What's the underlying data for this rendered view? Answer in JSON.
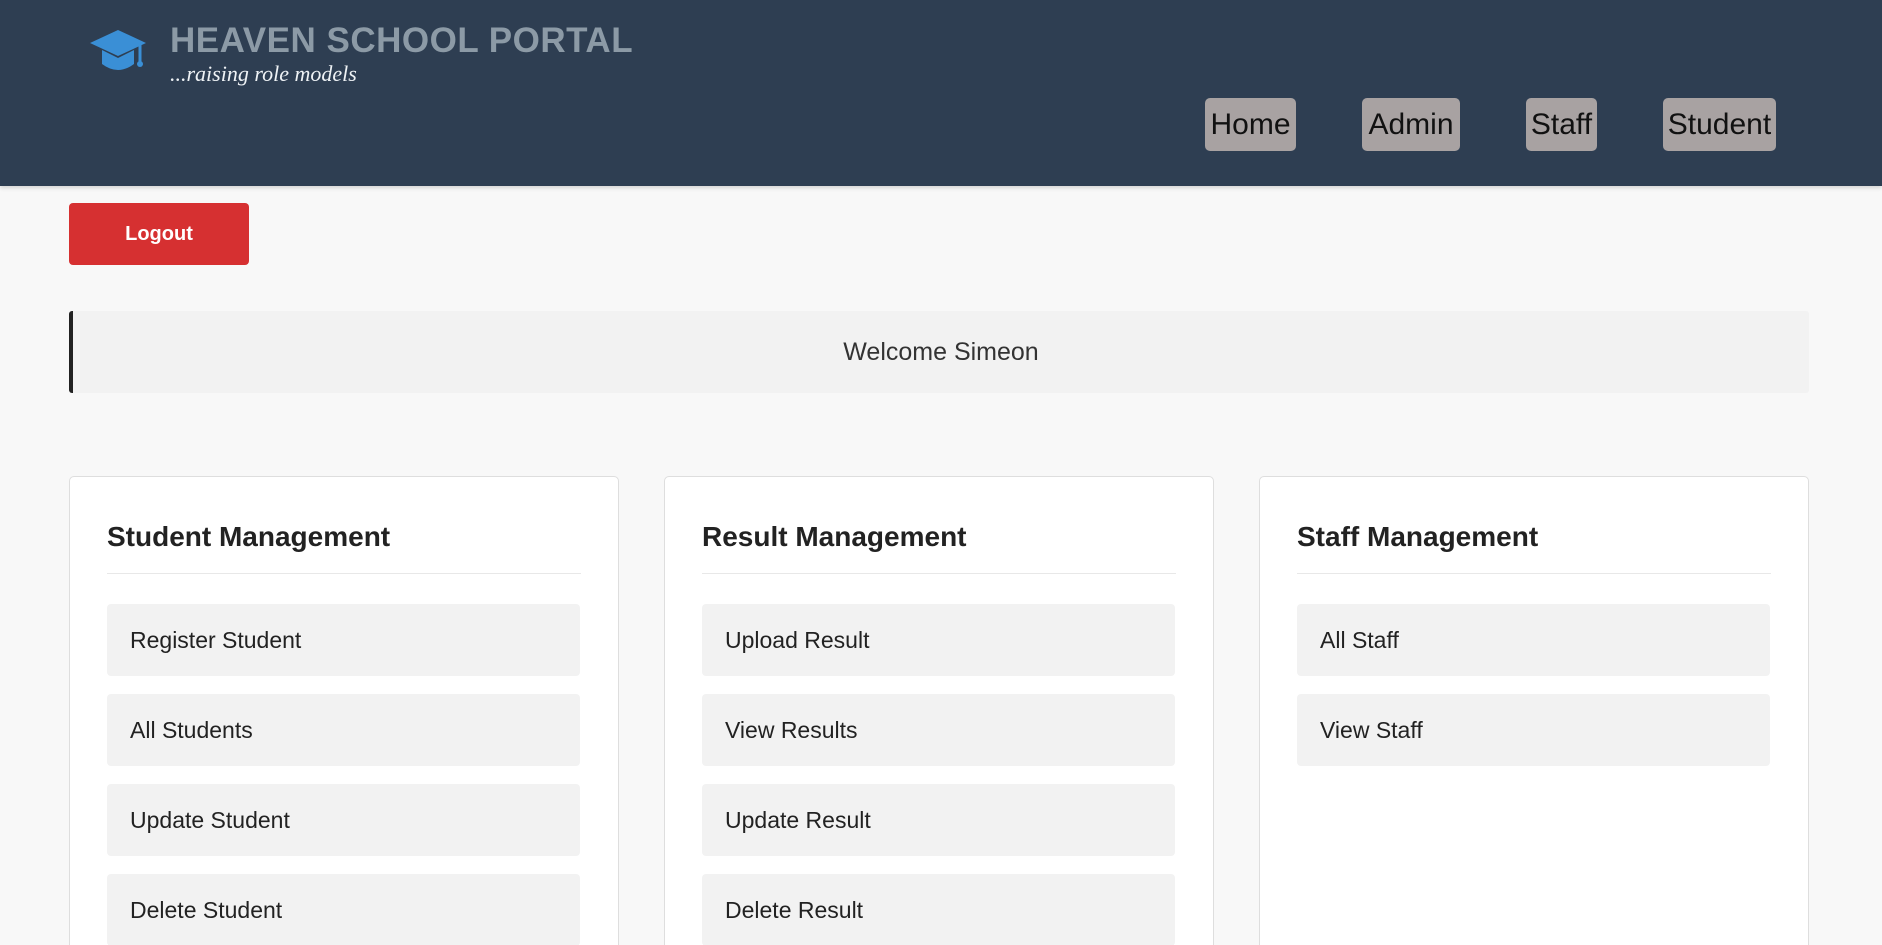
{
  "header": {
    "title": "HEAVEN SCHOOL PORTAL",
    "tagline": "...raising role models",
    "logo_icon": "graduation-cap-icon",
    "background_color": "#2e3e52"
  },
  "nav": {
    "items": [
      "Home",
      "Admin",
      "Staff",
      "Student"
    ]
  },
  "logout": {
    "label": "Logout",
    "color": "#d63031"
  },
  "welcome": {
    "text": "Welcome Simeon"
  },
  "cards": [
    {
      "title": "Student Management",
      "items": [
        "Register Student",
        "All Students",
        "Update Student",
        "Delete Student"
      ]
    },
    {
      "title": "Result Management",
      "items": [
        "Upload Result",
        "View Results",
        "Update Result",
        "Delete Result"
      ]
    },
    {
      "title": "Staff Management",
      "items": [
        "All Staff",
        "View Staff"
      ]
    }
  ]
}
